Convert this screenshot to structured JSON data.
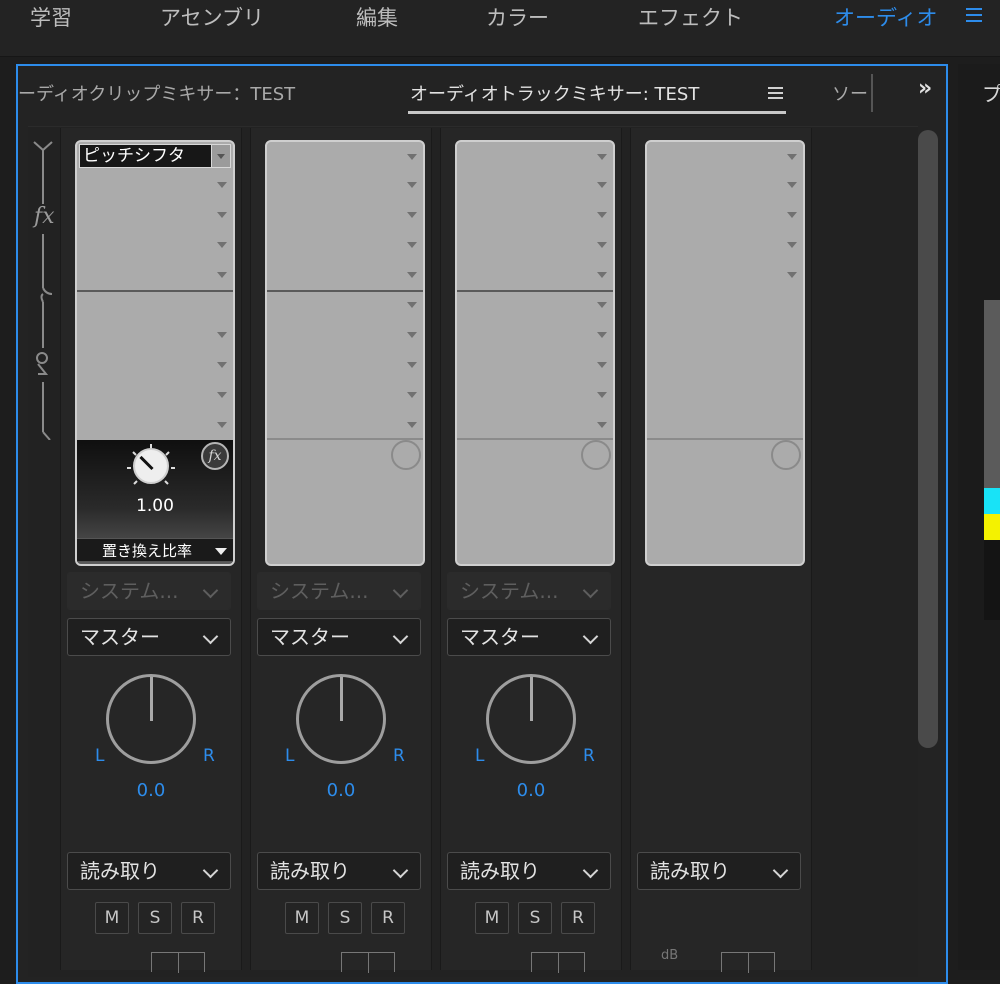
{
  "workspace": {
    "items": [
      "学習",
      "アセンブリ",
      "編集",
      "カラー",
      "エフェクト",
      "オーディオ"
    ],
    "active": "オーディオ",
    "menu_icon": "hamburger-icon"
  },
  "panel": {
    "tabs": {
      "clip_mixer": "ーディオクリップミキサー：TEST",
      "track_mixer": "オーディオトラックミキサー: TEST",
      "source": "ソー"
    },
    "overflow_label": "»",
    "right_panel_char": "プ"
  },
  "colors": {
    "accent": "#2d8ceb",
    "effects_box": "#ababab",
    "preview_cyan": "#18e3f7",
    "preview_yellow": "#f4f200"
  },
  "strips": [
    {
      "effect": {
        "name": "ピッチシフタ",
        "param_value": "1.00",
        "param_name": "置き換え比率",
        "fx_label": "fx"
      },
      "input": "システム...",
      "output": "マスター",
      "pan": {
        "left": "L",
        "right": "R",
        "value": "0.0"
      },
      "automation": "読み取り",
      "buttons": {
        "mute": "M",
        "solo": "S",
        "record": "R"
      }
    },
    {
      "input": "システム...",
      "output": "マスター",
      "pan": {
        "left": "L",
        "right": "R",
        "value": "0.0"
      },
      "automation": "読み取り",
      "buttons": {
        "mute": "M",
        "solo": "S",
        "record": "R"
      }
    },
    {
      "input": "システム...",
      "output": "マスター",
      "pan": {
        "left": "L",
        "right": "R",
        "value": "0.0"
      },
      "automation": "読み取り",
      "buttons": {
        "mute": "M",
        "solo": "S",
        "record": "R"
      }
    },
    {
      "automation": "読み取り",
      "meter_label": "dB"
    }
  ],
  "collapse": {
    "fx_label": "fx"
  }
}
